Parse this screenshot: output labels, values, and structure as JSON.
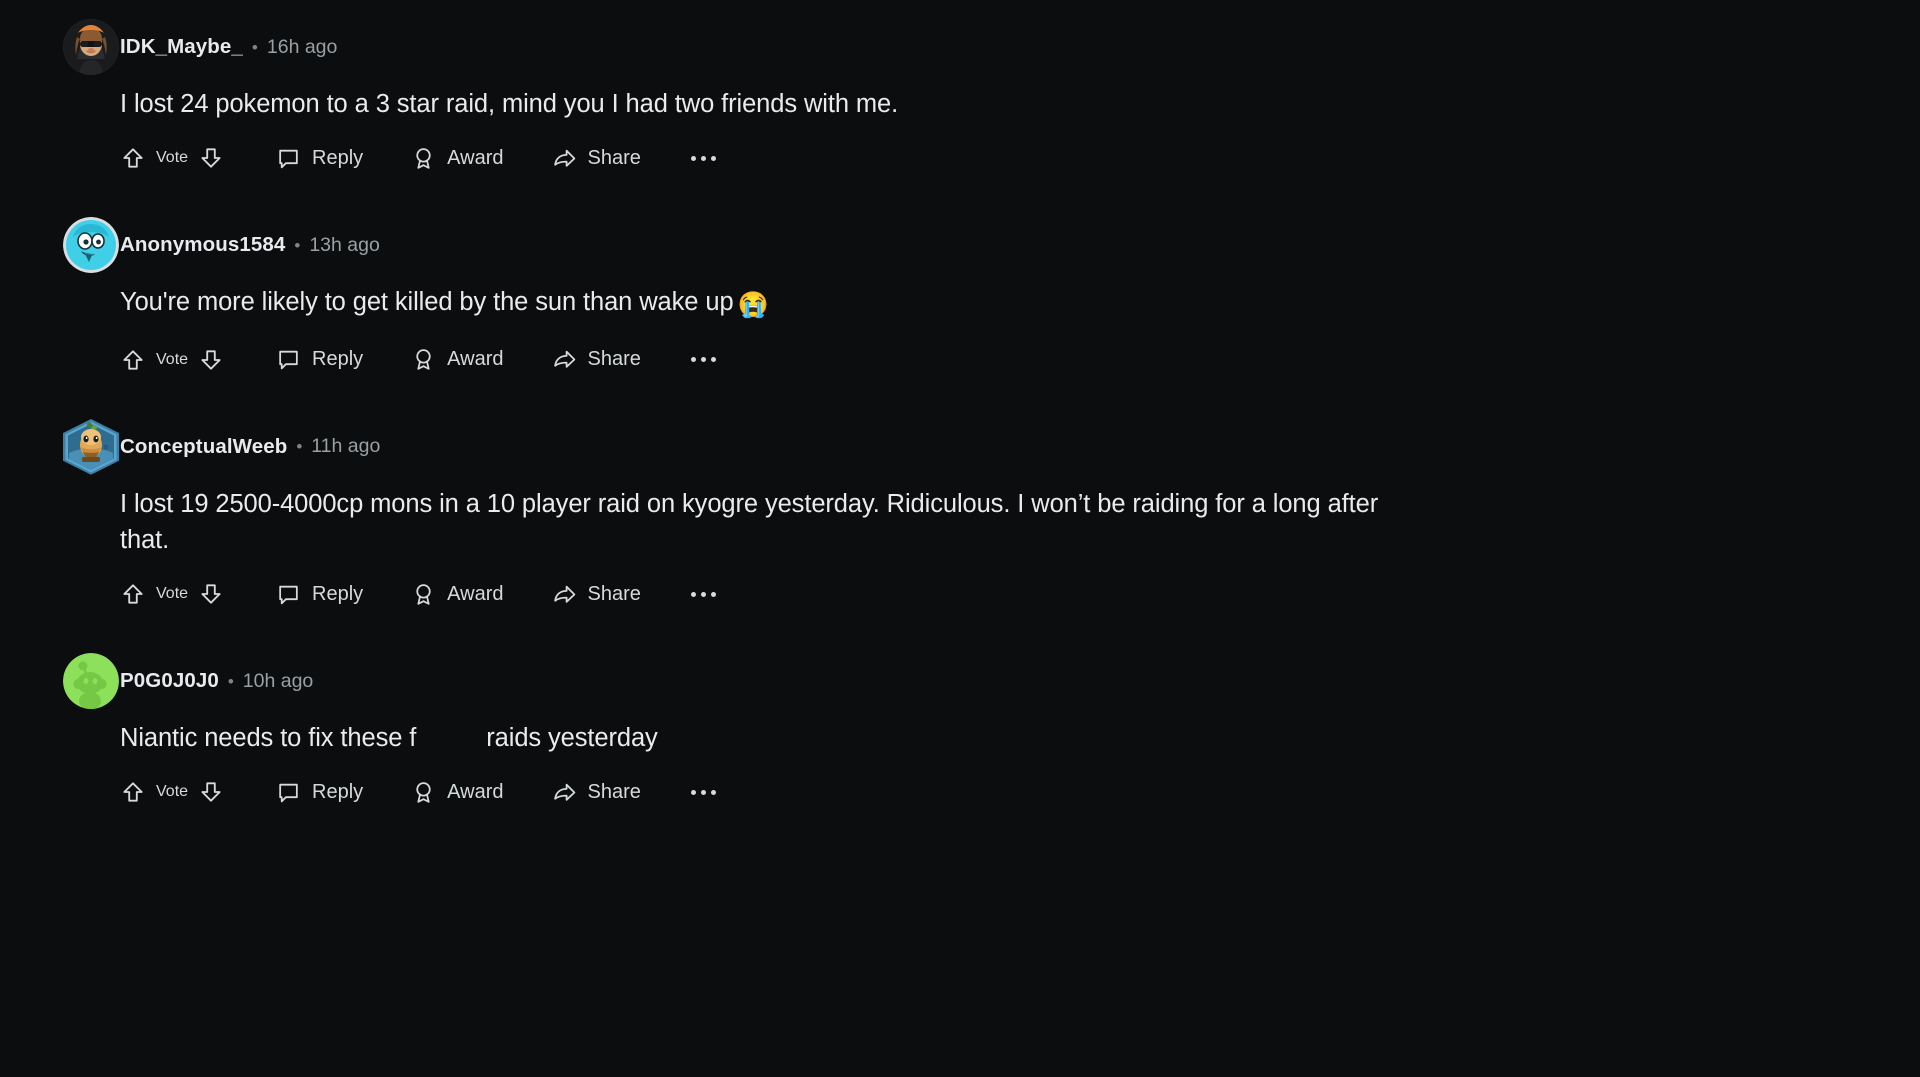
{
  "theme": {
    "background": "#0b0d0e",
    "text_primary": "#e9ebed",
    "text_muted": "#9aa0a4"
  },
  "actions": {
    "vote_label": "Vote",
    "reply_label": "Reply",
    "award_label": "Award",
    "share_label": "Share",
    "more_label": "..."
  },
  "comments": [
    {
      "username": "IDK_Maybe_",
      "separator": "•",
      "timestamp": "16h ago",
      "body": "I lost 24 pokemon to a 3 star raid, mind you I had two friends with me.",
      "body_line2": "",
      "emoji": "",
      "avatar": "girl-sunglasses-avatar"
    },
    {
      "username": "Anonymous1584",
      "separator": "•",
      "timestamp": "13h ago",
      "body": "You're more likely to get killed by the sun than wake up",
      "body_line2": "",
      "emoji": "😭",
      "avatar": "cyan-monster-avatar"
    },
    {
      "username": "ConceptualWeeb",
      "separator": "•",
      "timestamp": "11h ago",
      "body": "I lost 19 2500-4000cp mons in a 10 player raid on kyogre yesterday. Ridiculous. I won’t be raiding for a long",
      "body_line2": "after that.",
      "emoji": "",
      "avatar": "hex-snoo-avatar"
    },
    {
      "username": "P0G0J0J0",
      "separator": "•",
      "timestamp": "10h ago",
      "body_prefix": "Niantic needs to fix these f",
      "body_suffix": "raids yesterday",
      "body": "",
      "body_line2": "",
      "emoji": "",
      "avatar": "green-snoo-avatar"
    }
  ]
}
